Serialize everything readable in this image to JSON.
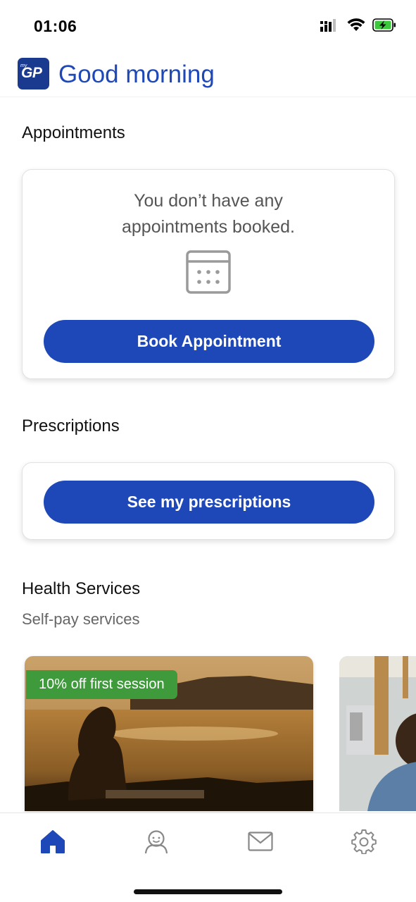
{
  "status_bar": {
    "time": "01:06",
    "icons": [
      "cellular-icon",
      "wifi-icon",
      "battery-charging-icon"
    ]
  },
  "header": {
    "logo_text": "GP",
    "logo_prefix": "my",
    "greeting": "Good morning"
  },
  "appointments": {
    "title": "Appointments",
    "empty_message": "You don’t have any appointments booked.",
    "button_label": "Book Appointment",
    "icon": "calendar-icon"
  },
  "prescriptions": {
    "title": "Prescriptions",
    "button_label": "See my prescriptions"
  },
  "health_services": {
    "title": "Health Services",
    "subtitle": "Self-pay services",
    "cards": [
      {
        "badge": "10% off first session",
        "image": "woman-sitting-by-lake-sunset"
      },
      {
        "badge": "",
        "image": "person-portrait"
      }
    ]
  },
  "tab_bar": {
    "items": [
      {
        "icon": "home-icon",
        "active": true
      },
      {
        "icon": "profile-icon",
        "active": false
      },
      {
        "icon": "mail-icon",
        "active": false
      },
      {
        "icon": "gear-icon",
        "active": false
      }
    ]
  },
  "colors": {
    "brand_blue": "#1e48b8",
    "logo_blue": "#1a3a8f",
    "badge_green": "#3e9a3a"
  }
}
